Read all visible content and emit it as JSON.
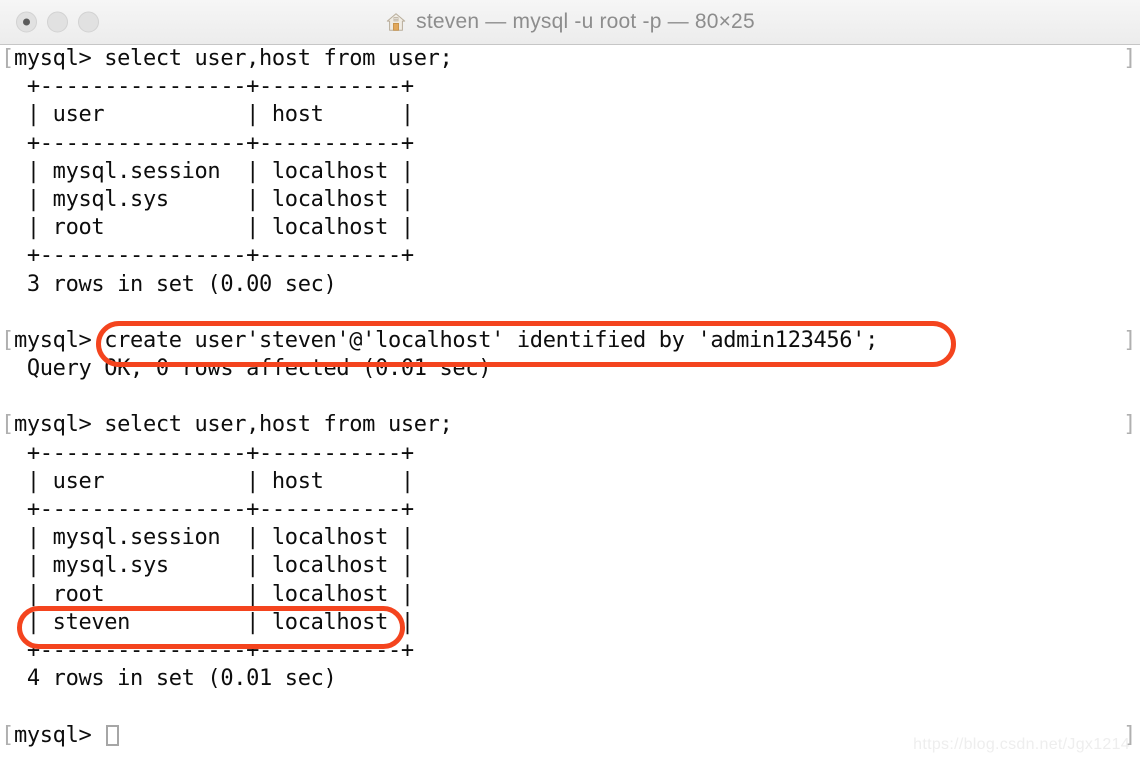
{
  "window": {
    "title": "steven — mysql -u root -p — 80×25",
    "home_icon": "home-icon",
    "traffic_lights": [
      {
        "name": "close-button",
        "label": ""
      },
      {
        "name": "minimize-button",
        "label": ""
      },
      {
        "name": "zoom-button",
        "label": ""
      }
    ]
  },
  "terminal": {
    "prompt_mark_left": "[",
    "prompt_mark_right": "]",
    "cursor": "block-cursor",
    "lines": [
      {
        "text": "mysql> select user,host from user;",
        "prompt": true
      },
      {
        "text": " +----------------+-----------+",
        "prompt": false
      },
      {
        "text": " | user           | host      |",
        "prompt": false
      },
      {
        "text": " +----------------+-----------+",
        "prompt": false
      },
      {
        "text": " | mysql.session  | localhost |",
        "prompt": false
      },
      {
        "text": " | mysql.sys      | localhost |",
        "prompt": false
      },
      {
        "text": " | root           | localhost |",
        "prompt": false
      },
      {
        "text": " +----------------+-----------+",
        "prompt": false
      },
      {
        "text": " 3 rows in set (0.00 sec)",
        "prompt": false
      },
      {
        "text": "",
        "prompt": false
      },
      {
        "text": "mysql> create user'steven'@'localhost' identified by 'admin123456';",
        "prompt": true
      },
      {
        "text": " Query OK, 0 rows affected (0.01 sec)",
        "prompt": false
      },
      {
        "text": "",
        "prompt": false
      },
      {
        "text": "mysql> select user,host from user;",
        "prompt": true
      },
      {
        "text": " +----------------+-----------+",
        "prompt": false
      },
      {
        "text": " | user           | host      |",
        "prompt": false
      },
      {
        "text": " +----------------+-----------+",
        "prompt": false
      },
      {
        "text": " | mysql.session  | localhost |",
        "prompt": false
      },
      {
        "text": " | mysql.sys      | localhost |",
        "prompt": false
      },
      {
        "text": " | root           | localhost |",
        "prompt": false
      },
      {
        "text": " | steven         | localhost |",
        "prompt": false
      },
      {
        "text": " +----------------+-----------+",
        "prompt": false
      },
      {
        "text": " 4 rows in set (0.01 sec)",
        "prompt": false
      },
      {
        "text": "",
        "prompt": false
      },
      {
        "text": "mysql> ",
        "prompt": true,
        "cursor": true
      }
    ]
  },
  "annotations": {
    "color": "#f4441e",
    "create_user_command": "create user'steven'@'localhost' identified by 'admin123456';",
    "steven_row": "| steven         | localhost |"
  },
  "watermark": {
    "text": "https://blog.csdn.net/Jgx1214"
  }
}
